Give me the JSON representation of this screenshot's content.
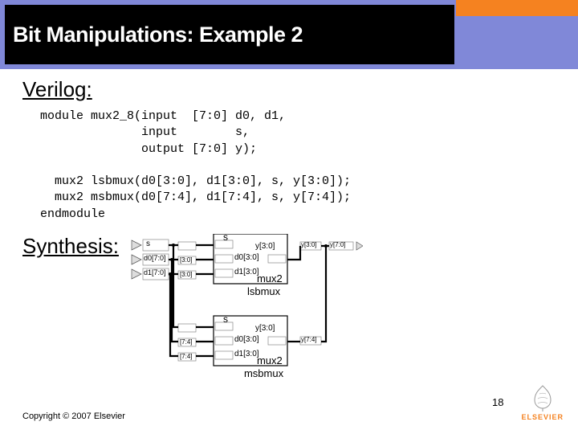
{
  "header": {
    "title": "Bit Manipulations: Example 2"
  },
  "sections": {
    "verilog_label": "Verilog:",
    "synthesis_label": "Synthesis:"
  },
  "code": {
    "l1": "module mux2_8(input  [7:0] d0, d1,",
    "l2": "              input        s,",
    "l3": "              output [7:0] y);",
    "l4": "",
    "l5": "  mux2 lsbmux(d0[3:0], d1[3:0], s, y[3:0]);",
    "l6": "  mux2 msbmux(d0[7:4], d1[7:4], s, y[7:4]);",
    "l7": "endmodule"
  },
  "diagram": {
    "block_label": "mux2",
    "inst1": "lsbmux",
    "inst2": "msbmux",
    "port_s": "s",
    "port_d0": "d0[3:0]",
    "port_d1": "d1[3:0]",
    "port_y": "y[3:0]",
    "in_s": "s",
    "in_d0": "d0[7:0]",
    "in_d1": "d1[7:0]",
    "out_y70": "y[7:0]",
    "slice_30": "[3:0]",
    "slice_74": "[7:4]",
    "out_y30": "y[3:0]",
    "out_y74": "y[7:4]"
  },
  "footer": {
    "copyright": "Copyright © 2007 Elsevier",
    "page": "18",
    "publisher": "ELSEVIER"
  }
}
